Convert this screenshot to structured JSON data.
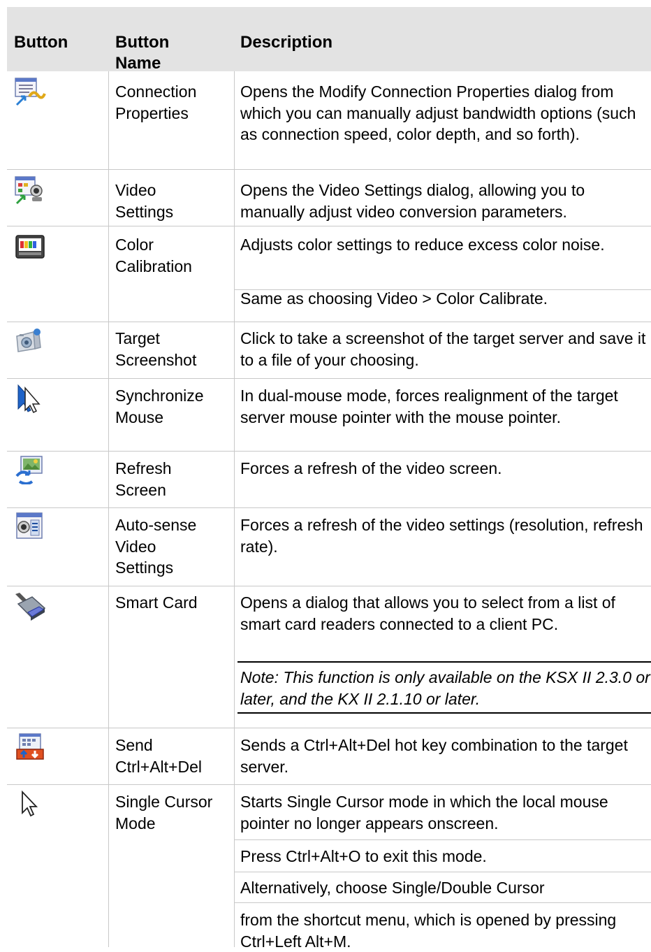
{
  "table": {
    "headers": {
      "button": "Button",
      "name_line1": "Button",
      "name_line2": "Name",
      "description": "Description"
    },
    "rows": [
      {
        "icon": "connection-properties-icon",
        "name": [
          "Connection",
          "Properties"
        ],
        "description": [
          "Opens the Modify Connection Properties dialog from which you can manually adjust bandwidth options (such as connection speed, color depth, and so forth)."
        ]
      },
      {
        "icon": "video-settings-icon",
        "name": [
          "Video",
          "Settings"
        ],
        "description": [
          "Opens the Video Settings dialog, allowing you to manually adjust video conversion parameters."
        ]
      },
      {
        "icon": "color-calibration-icon",
        "name": [
          "Color",
          "Calibration"
        ],
        "description": [
          "Adjusts color settings to reduce excess color noise.",
          "Same as choosing Video > Color Calibrate."
        ]
      },
      {
        "icon": "camera-icon",
        "name": [
          "Target",
          "Screenshot"
        ],
        "description": [
          "Click to take a screenshot of the target server and save it to a file of your choosing."
        ]
      },
      {
        "icon": "synchronize-mouse-icon",
        "name": [
          "Synchronize",
          "Mouse"
        ],
        "description": [
          "In dual-mouse mode, forces realignment of the target server mouse pointer with the mouse pointer."
        ]
      },
      {
        "icon": "refresh-screen-icon",
        "name": [
          "Refresh",
          "Screen"
        ],
        "description": [
          "Forces a refresh of the video screen."
        ]
      },
      {
        "icon": "auto-sense-video-icon",
        "name": [
          "Auto-sense",
          "Video",
          "Settings"
        ],
        "description": [
          "Forces a refresh of the video settings (resolution, refresh rate)."
        ]
      },
      {
        "icon": "smart-card-icon",
        "name": [
          "Smart Card"
        ],
        "description": [
          "Opens a dialog that allows you to select from a list of smart card readers connected to a client PC."
        ],
        "note": "Note: This function is only available on the KSX II 2.3.0 or later, and the KX II 2.1.10 or later."
      },
      {
        "icon": "ctrl-alt-del-icon",
        "name": [
          "Send",
          "Ctrl+Alt+Del"
        ],
        "description": [
          "Sends a Ctrl+Alt+Del hot key combination to the target server."
        ]
      },
      {
        "icon": "cursor-arrow-icon",
        "name": [
          "Single Cursor",
          "Mode"
        ],
        "description": [
          "Starts Single Cursor mode in which the local mouse pointer no longer appears onscreen.",
          "Press Ctrl+Alt+O to exit this mode.",
          "Alternatively, choose Single/Double Cursor",
          "from the shortcut menu, which is opened by pressing Ctrl+Left Alt+M."
        ]
      }
    ]
  }
}
